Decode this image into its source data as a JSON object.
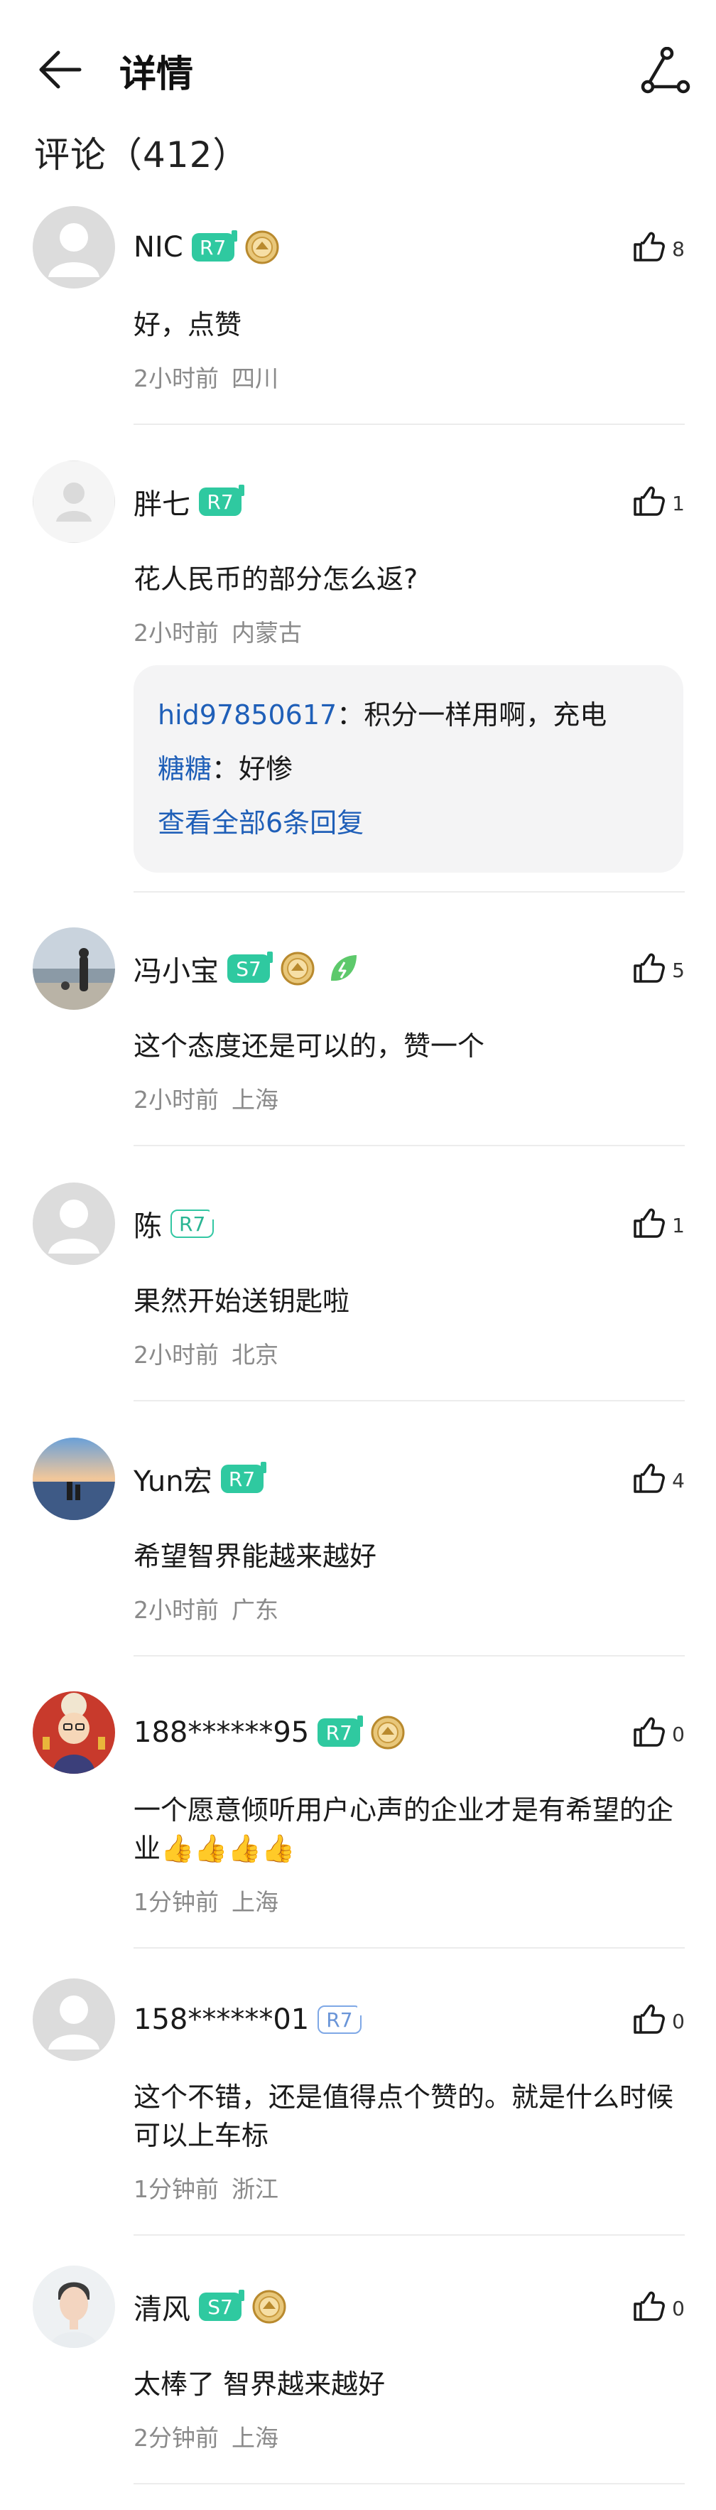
{
  "header": {
    "title": "详情",
    "comments_title": "评论（412）"
  },
  "comments": [
    {
      "name": "NIC",
      "level": "R7",
      "level_style": "solid",
      "medal": true,
      "leaf": false,
      "likes": "8",
      "text": "好，点赞",
      "time": "2小时前",
      "location": "四川",
      "avatar": "default-gray"
    },
    {
      "name": "胖七",
      "level": "R7",
      "level_style": "solid",
      "medal": false,
      "leaf": false,
      "likes": "1",
      "text": "花人民币的部分怎么返?",
      "time": "2小时前",
      "location": "内蒙古",
      "avatar": "default-light",
      "replies": [
        {
          "name": "hid97850617",
          "text": "：积分一样用啊，充电"
        },
        {
          "name": "糖糖",
          "text": "：好惨"
        }
      ],
      "replies_link": "查看全部6条回复"
    },
    {
      "name": "冯小宝",
      "level": "S7",
      "level_style": "solid",
      "medal": true,
      "leaf": true,
      "likes": "5",
      "text": "这个态度还是可以的，赞一个",
      "time": "2小时前",
      "location": "上海",
      "avatar": "beach"
    },
    {
      "name": "陈",
      "level": "R7",
      "level_style": "outline",
      "medal": false,
      "leaf": false,
      "likes": "1",
      "text": "果然开始送钥匙啦",
      "time": "2小时前",
      "location": "北京",
      "avatar": "default-gray"
    },
    {
      "name": "Yun宏",
      "level": "R7",
      "level_style": "solid",
      "medal": false,
      "leaf": false,
      "likes": "4",
      "text": "希望智界能越来越好",
      "time": "2小时前",
      "location": "广东",
      "avatar": "sunset"
    },
    {
      "name": "188******95",
      "level": "R7",
      "level_style": "solid",
      "medal": true,
      "leaf": false,
      "likes": "0",
      "text": "一个愿意倾听用户心声的企业才是有希望的企业👍👍👍👍",
      "time": "1分钟前",
      "location": "上海",
      "avatar": "cartoon"
    },
    {
      "name": "158******01",
      "level": "R7",
      "level_style": "outline-blue",
      "medal": false,
      "leaf": false,
      "likes": "0",
      "text": "这个不错，还是值得点个赞的。就是什么时候可以上车标",
      "time": "1分钟前",
      "location": "浙江",
      "avatar": "default-gray"
    },
    {
      "name": "清风",
      "level": "S7",
      "level_style": "solid",
      "medal": true,
      "leaf": false,
      "likes": "0",
      "text": "太棒了 智界越来越好",
      "time": "2分钟前",
      "location": "上海",
      "avatar": "man"
    }
  ]
}
